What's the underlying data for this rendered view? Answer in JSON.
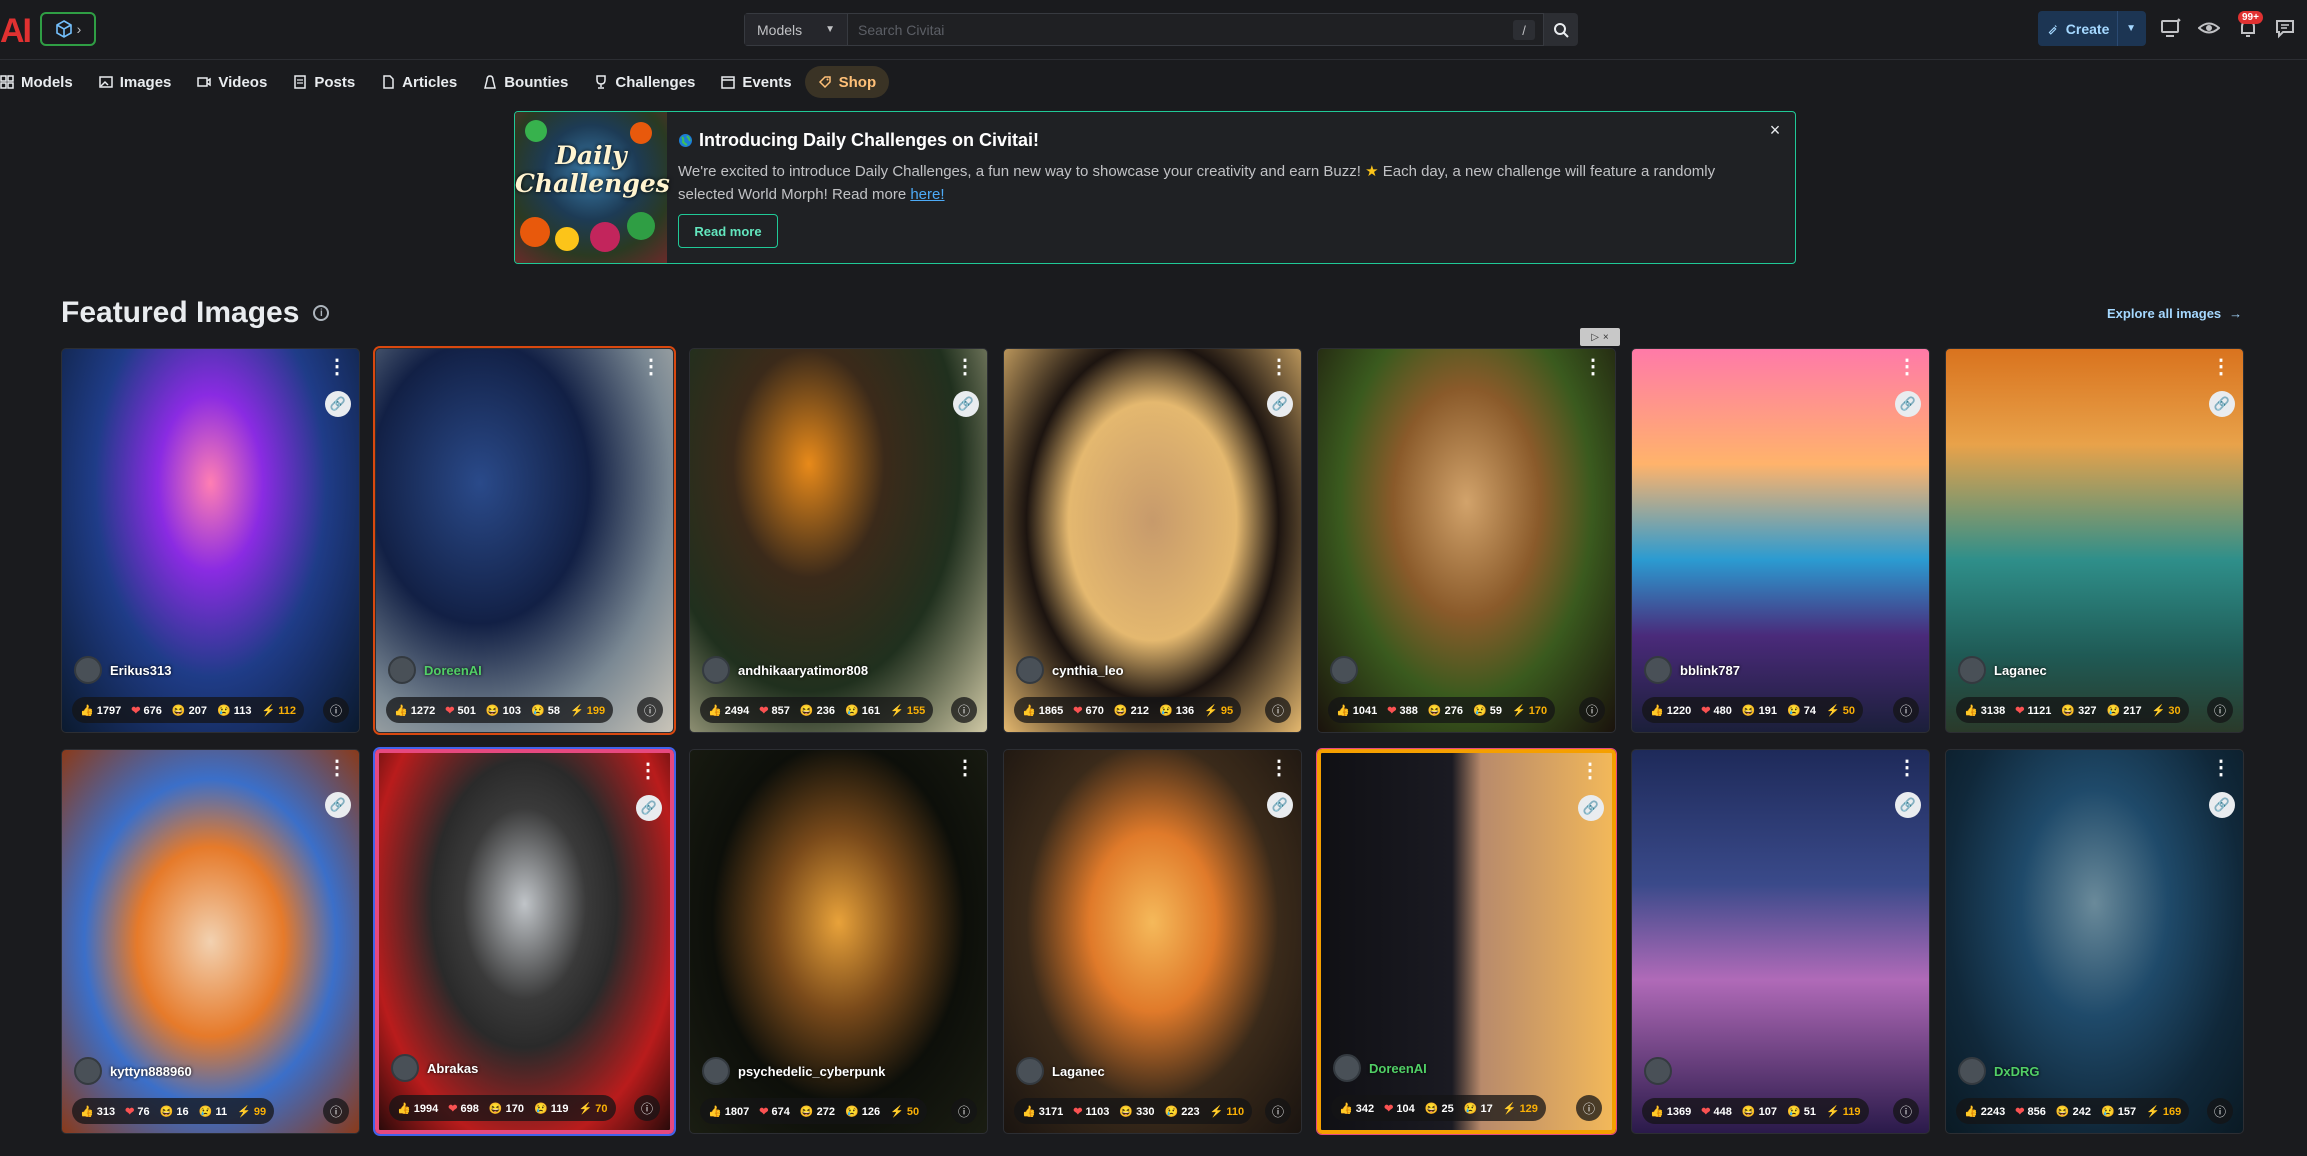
{
  "app": {
    "logo_text": "AI"
  },
  "search": {
    "category": "Models",
    "placeholder": "Search Civitai",
    "shortcut": "/"
  },
  "header": {
    "create_label": "Create",
    "notif_count": "99+"
  },
  "nav": [
    {
      "label": "Models",
      "icon": "models-icon"
    },
    {
      "label": "Images",
      "icon": "images-icon"
    },
    {
      "label": "Videos",
      "icon": "videos-icon"
    },
    {
      "label": "Posts",
      "icon": "posts-icon"
    },
    {
      "label": "Articles",
      "icon": "articles-icon"
    },
    {
      "label": "Bounties",
      "icon": "bounties-icon"
    },
    {
      "label": "Challenges",
      "icon": "challenges-icon"
    },
    {
      "label": "Events",
      "icon": "events-icon"
    },
    {
      "label": "Shop",
      "icon": "shop-icon"
    }
  ],
  "banner": {
    "image_text": "Daily Challenges",
    "title": "Introducing Daily Challenges on Civitai!",
    "body_1": "We're excited to introduce Daily Challenges, a fun new way to showcase your creativity and earn Buzz! ",
    "body_2": " Each day, a new challenge will feature a randomly selected World Morph! Read more ",
    "link": "here!",
    "button": "Read more"
  },
  "section": {
    "title": "Featured Images",
    "explore": "Explore all images"
  },
  "colors": {
    "accent": "#20c997",
    "create_bg": "#1c3553",
    "buzz": "#fab005",
    "heart": "#fa5252"
  },
  "cards": [
    {
      "user": "Erikus313",
      "likes": "1797",
      "hearts": "676",
      "laughs": "207",
      "cries": "113",
      "buzz": "112"
    },
    {
      "user": "DoreenAI",
      "likes": "1272",
      "hearts": "501",
      "laughs": "103",
      "cries": "58",
      "buzz": "199"
    },
    {
      "user": "andhikaaryatimor808",
      "likes": "2494",
      "hearts": "857",
      "laughs": "236",
      "cries": "161",
      "buzz": "155"
    },
    {
      "user": "cynthia_leo",
      "likes": "1865",
      "hearts": "670",
      "laughs": "212",
      "cries": "136",
      "buzz": "95"
    },
    {
      "user": "",
      "likes": "1041",
      "hearts": "388",
      "laughs": "276",
      "cries": "59",
      "buzz": "170"
    },
    {
      "user": "bblink787",
      "likes": "1220",
      "hearts": "480",
      "laughs": "191",
      "cries": "74",
      "buzz": "50"
    },
    {
      "user": "Laganec",
      "likes": "3138",
      "hearts": "1121",
      "laughs": "327",
      "cries": "217",
      "buzz": "30"
    },
    {
      "user": "kyttyn888960",
      "likes": "313",
      "hearts": "76",
      "laughs": "16",
      "cries": "11",
      "buzz": "99"
    },
    {
      "user": "Abrakas",
      "likes": "1994",
      "hearts": "698",
      "laughs": "170",
      "cries": "119",
      "buzz": "70"
    },
    {
      "user": "psychedelic_cyberpunk",
      "likes": "1807",
      "hearts": "674",
      "laughs": "272",
      "cries": "126",
      "buzz": "50"
    },
    {
      "user": "Laganec",
      "likes": "3171",
      "hearts": "1103",
      "laughs": "330",
      "cries": "223",
      "buzz": "110"
    },
    {
      "user": "DoreenAI",
      "likes": "342",
      "hearts": "104",
      "laughs": "25",
      "cries": "17",
      "buzz": "129"
    },
    {
      "user": "",
      "likes": "1369",
      "hearts": "448",
      "laughs": "107",
      "cries": "51",
      "buzz": "119"
    },
    {
      "user": "DxDRG",
      "likes": "2243",
      "hearts": "856",
      "laughs": "242",
      "cries": "157",
      "buzz": "169"
    }
  ]
}
